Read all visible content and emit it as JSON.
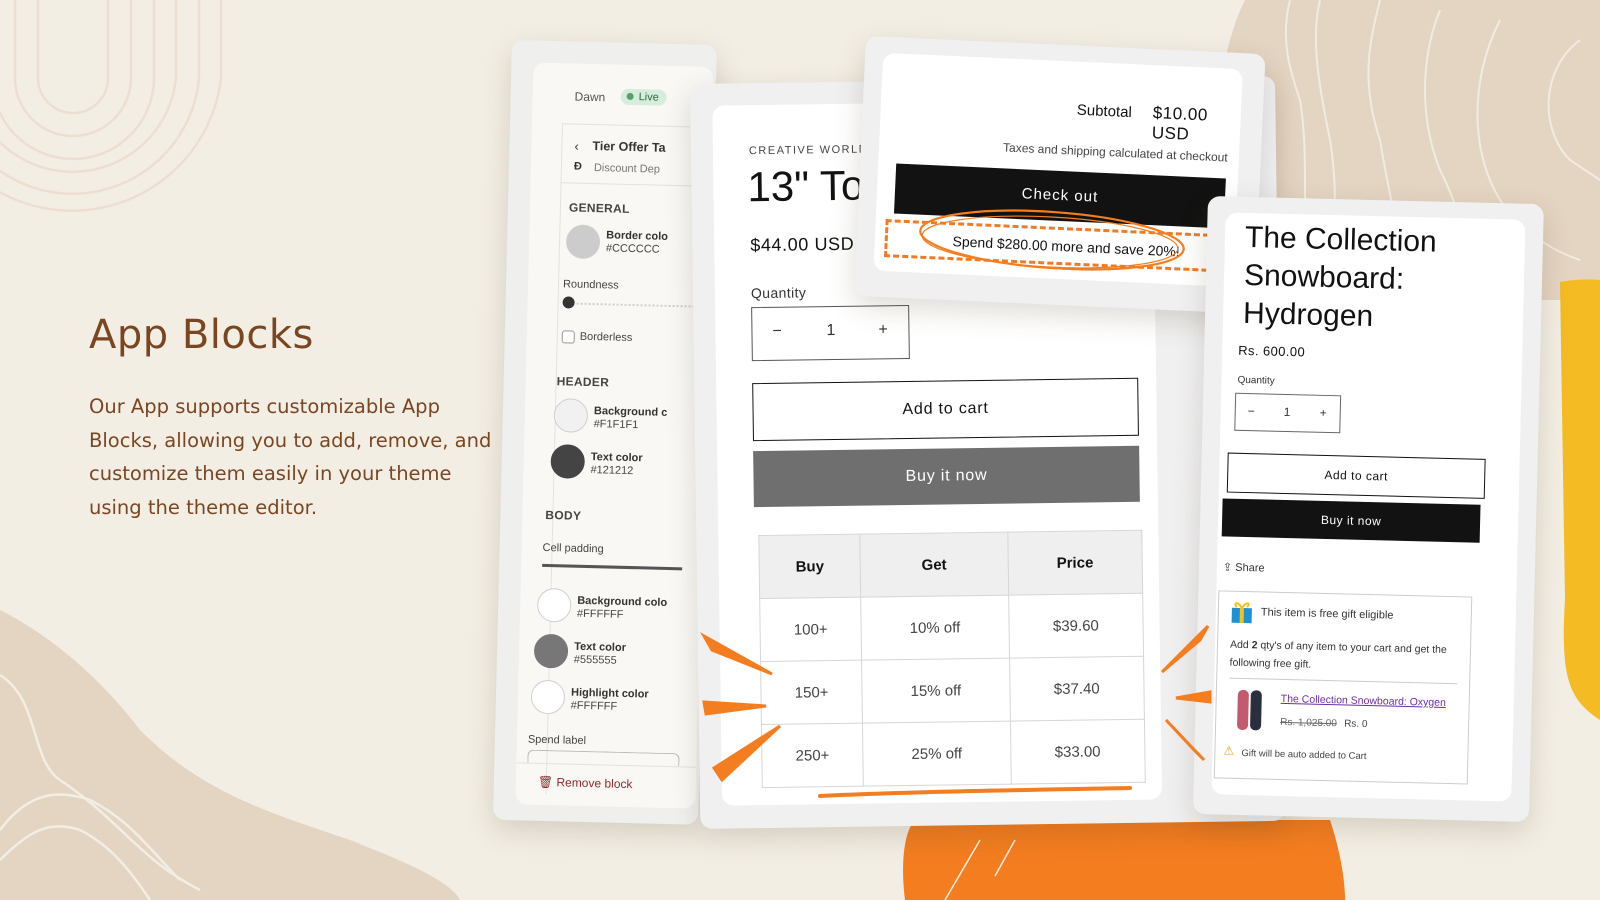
{
  "hero": {
    "title": "App Blocks",
    "description": "Our App supports customizable App Blocks, allowing you to add, remove, and customize them easily in your theme using the theme editor."
  },
  "colors": {
    "background": "#f3eee4",
    "shape_tan": "#e4d4c2",
    "accent_orange": "#f47d20",
    "accent_yellow": "#f4bb23",
    "hero_text": "#7a4622"
  },
  "editor": {
    "theme_name": "Dawn",
    "status_badge": "Live",
    "block_title": "Tier Offer Ta",
    "app_name": "Discount Dep",
    "sections": {
      "general": "GENERAL",
      "header": "HEADER",
      "body": "BODY"
    },
    "general": {
      "border_color": {
        "label": "Border colo",
        "value": "#CCCCCC"
      },
      "roundness_label": "Roundness",
      "borderless_label": "Borderless"
    },
    "header": {
      "background_color": {
        "label": "Background c",
        "value": "#F1F1F1"
      },
      "text_color": {
        "label": "Text color",
        "value": "#121212"
      }
    },
    "body": {
      "cell_padding_label": "Cell padding",
      "background_color": {
        "label": "Background colo",
        "value": "#FFFFFF"
      },
      "text_color": {
        "label": "Text color",
        "value": "#555555"
      },
      "highlight_color": {
        "label": "Highlight color",
        "value": "#FFFFFF"
      }
    },
    "spend_label": "Spend label",
    "remove_block": "Remove block"
  },
  "product": {
    "vendor": "CREATIVE WORLD",
    "title": "13\" To",
    "price": "$44.00 USD",
    "quantity_label": "Quantity",
    "quantity_value": "1",
    "minus": "−",
    "plus": "+",
    "add_to_cart": "Add to cart",
    "buy_it_now": "Buy it now",
    "tier_table": {
      "headers": [
        "Buy",
        "Get",
        "Price"
      ],
      "rows": [
        [
          "100+",
          "10% off",
          "$39.60"
        ],
        [
          "150+",
          "15% off",
          "$37.40"
        ],
        [
          "250+",
          "25% off",
          "$33.00"
        ]
      ]
    }
  },
  "cart": {
    "subtotal_label": "Subtotal",
    "subtotal_value": "$10.00 USD",
    "tax_note": "Taxes and shipping calculated at checkout",
    "checkout": "Check out",
    "spend_message": "Spend $280.00 more and save 20%!"
  },
  "gift_product": {
    "title": "The Collection Snowboard: Hydrogen",
    "price": "Rs. 600.00",
    "quantity_label": "Quantity",
    "quantity_value": "1",
    "minus": "−",
    "plus": "+",
    "add_to_cart": "Add to cart",
    "buy_it_now": "Buy it now",
    "share": "Share",
    "gift_box": {
      "eligible": "This item is free gift eligible",
      "desc_prefix": "Add ",
      "desc_qty": "2",
      "desc_suffix": " qty's of any item to your cart and get the following free gift.",
      "gift_name": "The Collection Snowboard: Oxygen",
      "old_price": "Rs. 1,025.00",
      "new_price": "Rs. 0",
      "note": "Gift will be auto added to Cart"
    }
  }
}
